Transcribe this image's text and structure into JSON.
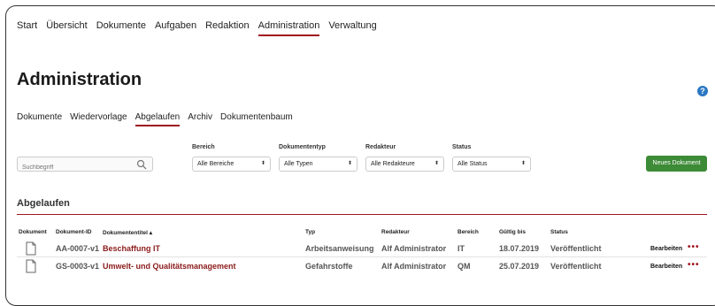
{
  "topnav": {
    "items": [
      "Start",
      "Übersicht",
      "Dokumente",
      "Aufgaben",
      "Redaktion",
      "Administration",
      "Verwaltung"
    ],
    "active": "Administration"
  },
  "page_title": "Administration",
  "help_icon_label": "?",
  "subnav": {
    "items": [
      "Dokumente",
      "Wiedervorlage",
      "Abgelaufen",
      "Archiv",
      "Dokumentenbaum"
    ],
    "active": "Abgelaufen"
  },
  "filters": {
    "search_placeholder": "Suchbegriff",
    "bereich": {
      "label": "Bereich",
      "value": "Alle Bereiche"
    },
    "dokumententyp": {
      "label": "Dokumententyp",
      "value": "Alle Typen"
    },
    "redakteur": {
      "label": "Redakteur",
      "value": "Alle Redakteure"
    },
    "status": {
      "label": "Status",
      "value": "Alle Status"
    }
  },
  "new_document_label": "Neues Dokument",
  "section_title": "Abgelaufen",
  "table": {
    "headers": {
      "dokument": "Dokument",
      "id": "Dokument-ID",
      "title": "Dokumententitel ▴",
      "typ": "Typ",
      "redakteur": "Redakteur",
      "bereich": "Bereich",
      "gueltig": "Gültig bis",
      "status": "Status"
    },
    "rows": [
      {
        "id": "AA-0007-v1",
        "title": "Beschaffung IT",
        "typ": "Arbeitsanweisung",
        "redakteur": "Alf Administrator",
        "bereich": "IT",
        "gueltig": "18.07.2019",
        "status": "Veröffentlicht",
        "edit": "Bearbeiten",
        "more": "•••"
      },
      {
        "id": "GS-0003-v1",
        "title": "Umwelt- und Qualitätsmanagement",
        "typ": "Gefahrstoffe",
        "redakteur": "Alf Administrator",
        "bereich": "QM",
        "gueltig": "25.07.2019",
        "status": "Veröffentlicht",
        "edit": "Bearbeiten",
        "more": "•••"
      }
    ]
  },
  "colors": {
    "accent": "#a0161e",
    "primary_button": "#3d8b37",
    "help": "#2b78c2"
  }
}
